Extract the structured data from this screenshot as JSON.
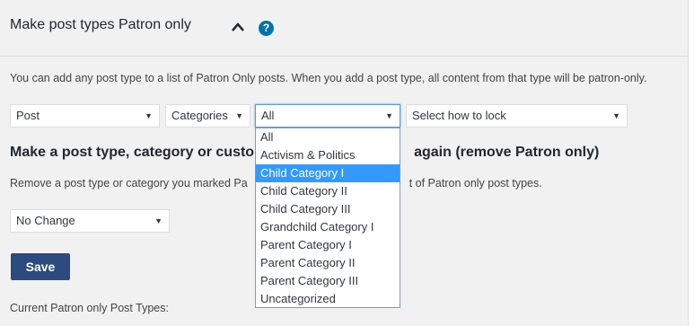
{
  "header": {
    "title": "Make post types Patron only"
  },
  "intro": "You can add any post type to a list of Patron Only posts. When you add a post type, all content from that type will be patron-only.",
  "selects": {
    "post_type": "Post",
    "taxonomy": "Categories",
    "term": "All",
    "lock": "Select how to lock"
  },
  "section2": {
    "heading_start": "Make a post type, category or custo",
    "heading_end": "again (remove Patron only)",
    "text_start": "Remove a post type or category you marked Pa",
    "text_end": "t of Patron only post types.",
    "select_value": "No Change"
  },
  "save_label": "Save",
  "current_label": "Current Patron only Post Types:",
  "dropdown": {
    "options": [
      "All",
      "Activism & Politics",
      "Child Category I",
      "Child Category II",
      "Child Category III",
      "Grandchild Category I",
      "Parent Category I",
      "Parent Category II",
      "Parent Category III",
      "Uncategorized"
    ],
    "selected": "Child Category I"
  },
  "colors": {
    "button_bg": "#2c4a7e",
    "help_icon": "#0073aa",
    "selection": "#3399ff"
  }
}
